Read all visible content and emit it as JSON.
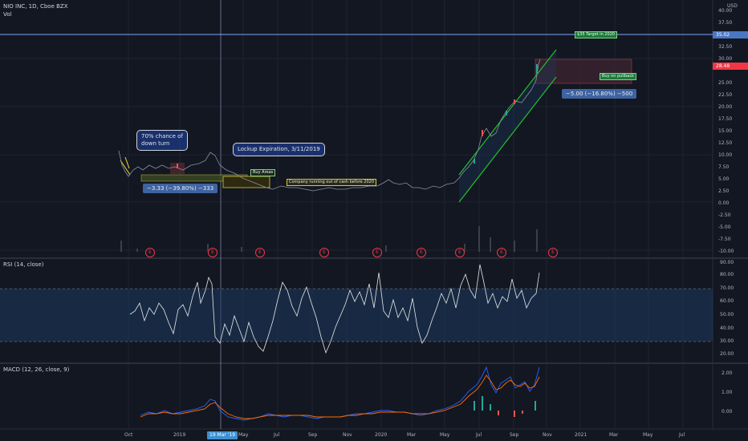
{
  "header": {
    "title": "NIO INC, 1D, Cboe BZX",
    "vol_label": "Vol",
    "currency": "USD"
  },
  "price_axis": [
    "40.00",
    "37.50",
    "35.00",
    "32.50",
    "30.00",
    "27.50",
    "25.00",
    "22.50",
    "20.00",
    "17.50",
    "15.00",
    "12.50",
    "10.00",
    "7.50",
    "5.00",
    "2.50",
    "0.00",
    "-2.50",
    "-5.00",
    "-7.50",
    "-10.00"
  ],
  "price_tags": {
    "target": "35.02",
    "current": "28.48"
  },
  "rsi": {
    "label": "RSI (14, close)",
    "axis": [
      "90.00",
      "80.00",
      "70.00",
      "60.00",
      "50.00",
      "40.00",
      "30.00",
      "20.00"
    ]
  },
  "macd": {
    "label": "MACD (12, 26, close, 9)",
    "axis": [
      "2.00",
      "1.00",
      "0.00"
    ]
  },
  "time_axis": [
    "Oct",
    "2019",
    "Mar",
    "May",
    "Jul",
    "Sep",
    "Nov",
    "2020",
    "Mar",
    "May",
    "Jul",
    "Sep",
    "Nov",
    "2021",
    "Mar",
    "May",
    "Jul"
  ],
  "crosshair_date": "19 Mar '19",
  "annotations": {
    "chance_callout": "70% chance of down turn",
    "lockup_callout": "Lockup Expiration, 3/11/2019",
    "buy_areas": "Buy Areas",
    "cash_note": "Company running out of cash before 2020",
    "target_note": "$35 Target in 2020",
    "pullback_note": "Buy on pullback",
    "measure_left": "−3.33 (−39.80%) −333",
    "measure_right": "−5.00 (−16.80%) −500"
  },
  "earnings_marker": "E",
  "colors": {
    "background": "#131722",
    "up_candle": "#26a69a",
    "down_candle": "#ef5350",
    "channel": "#22dd22",
    "rsi_band": "#1e3a5f",
    "macd_line": "#2962ff",
    "signal_line": "#ff6d00",
    "target_line": "#7aa7ff"
  }
}
